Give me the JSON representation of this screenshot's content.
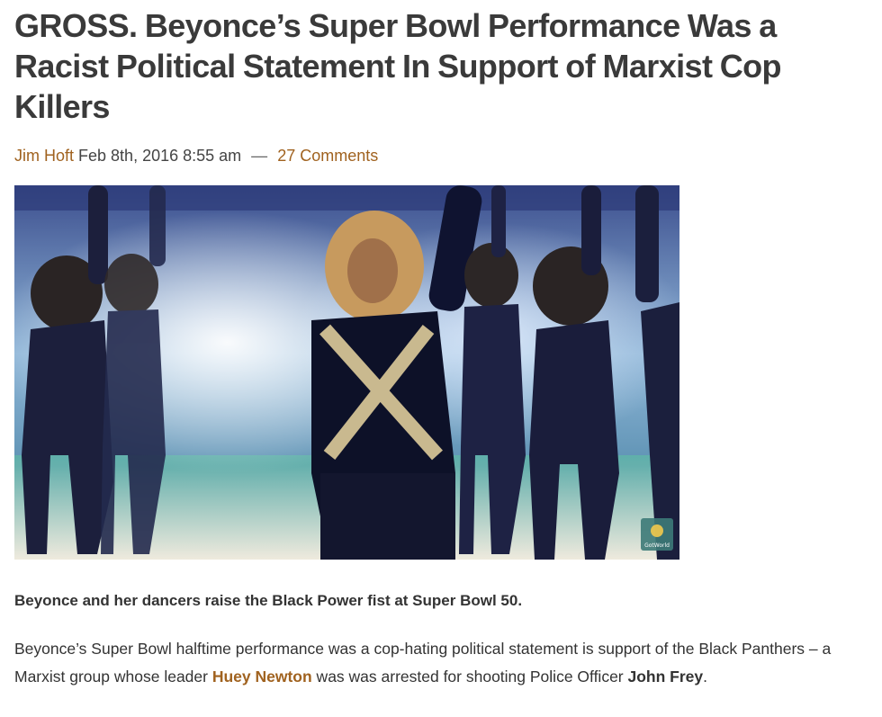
{
  "article": {
    "title": "GROSS. Beyonce’s Super Bowl Performance Was a Racist Political Statement In Support of Marxist Cop Killers",
    "author": "Jim Hoft",
    "date": "Feb 8th, 2016 8:55 am",
    "separator": "—",
    "comments_link": "27 Comments",
    "image_watermark_text": "GotWorld",
    "caption": "Beyonce and her dancers raise the Black Power fist at Super Bowl 50.",
    "body": {
      "text_1": "Beyonce’s Super Bowl halftime performance was a cop-hating political statement is support of the Black Panthers – a Marxist group whose leader ",
      "link_name": "Huey Newton",
      "text_2": " was was arrested for shooting Police Officer ",
      "officer_name": "John Frey",
      "text_3": "."
    }
  },
  "colors": {
    "link": "#a0621f",
    "title": "#3a3a3a",
    "text": "#333333"
  }
}
